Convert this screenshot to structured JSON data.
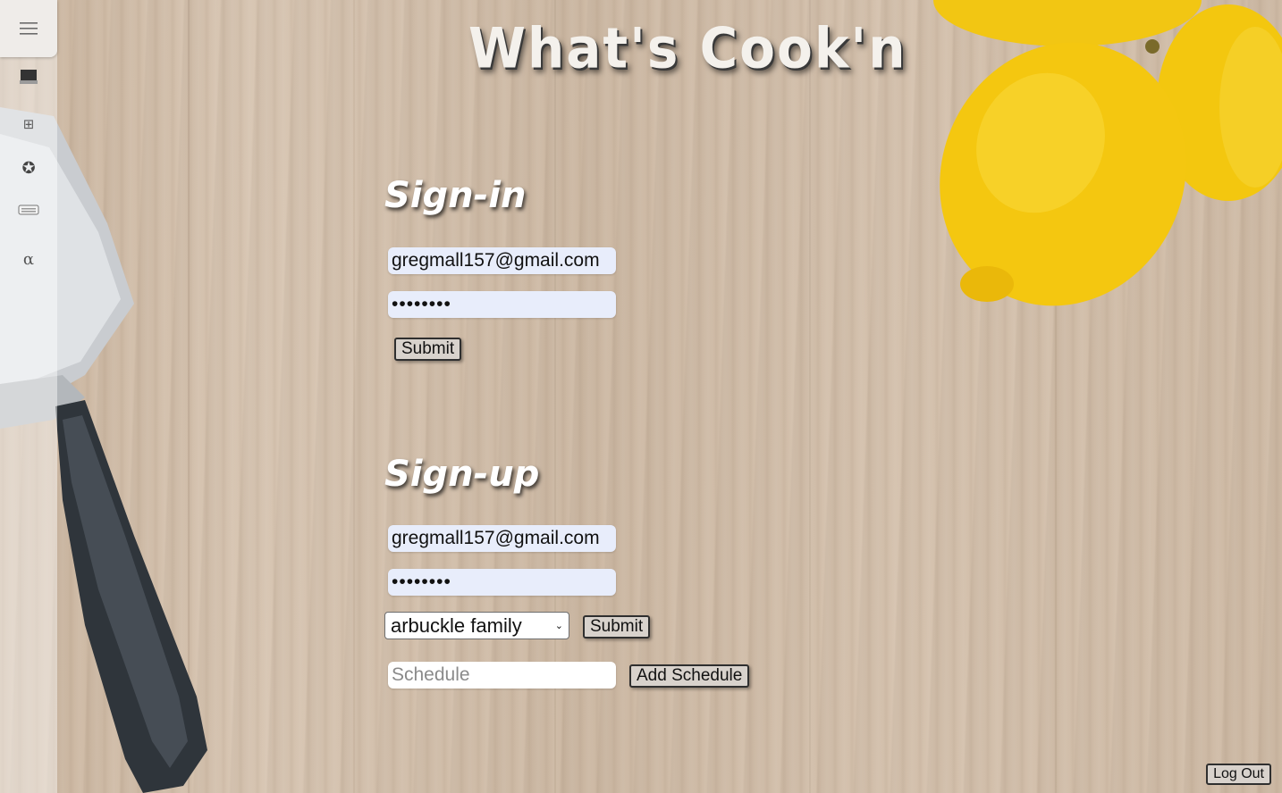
{
  "app": {
    "title": "What's Cook'n"
  },
  "sidebar": {
    "menu_icon": "hamburger-menu-icon",
    "items": [
      {
        "icon": "laptop-icon",
        "glyph": "▬"
      },
      {
        "icon": "grid-icon",
        "glyph": "⊞"
      },
      {
        "icon": "star-circle-icon",
        "glyph": "✪"
      },
      {
        "icon": "keyboard-icon",
        "glyph": "⌨"
      },
      {
        "icon": "alpha-icon",
        "glyph": "α"
      }
    ]
  },
  "signin": {
    "heading": "Sign-in",
    "email_value": "gregmall157@gmail.com",
    "password_value": "password",
    "submit_label": "Submit"
  },
  "signup": {
    "heading": "Sign-up",
    "email_value": "gregmall157@gmail.com",
    "password_value": "password",
    "family_selected": "arbuckle family",
    "submit_label": "Submit",
    "schedule_placeholder": "Schedule",
    "add_schedule_label": "Add Schedule"
  },
  "footer": {
    "logout_label": "Log Out"
  }
}
